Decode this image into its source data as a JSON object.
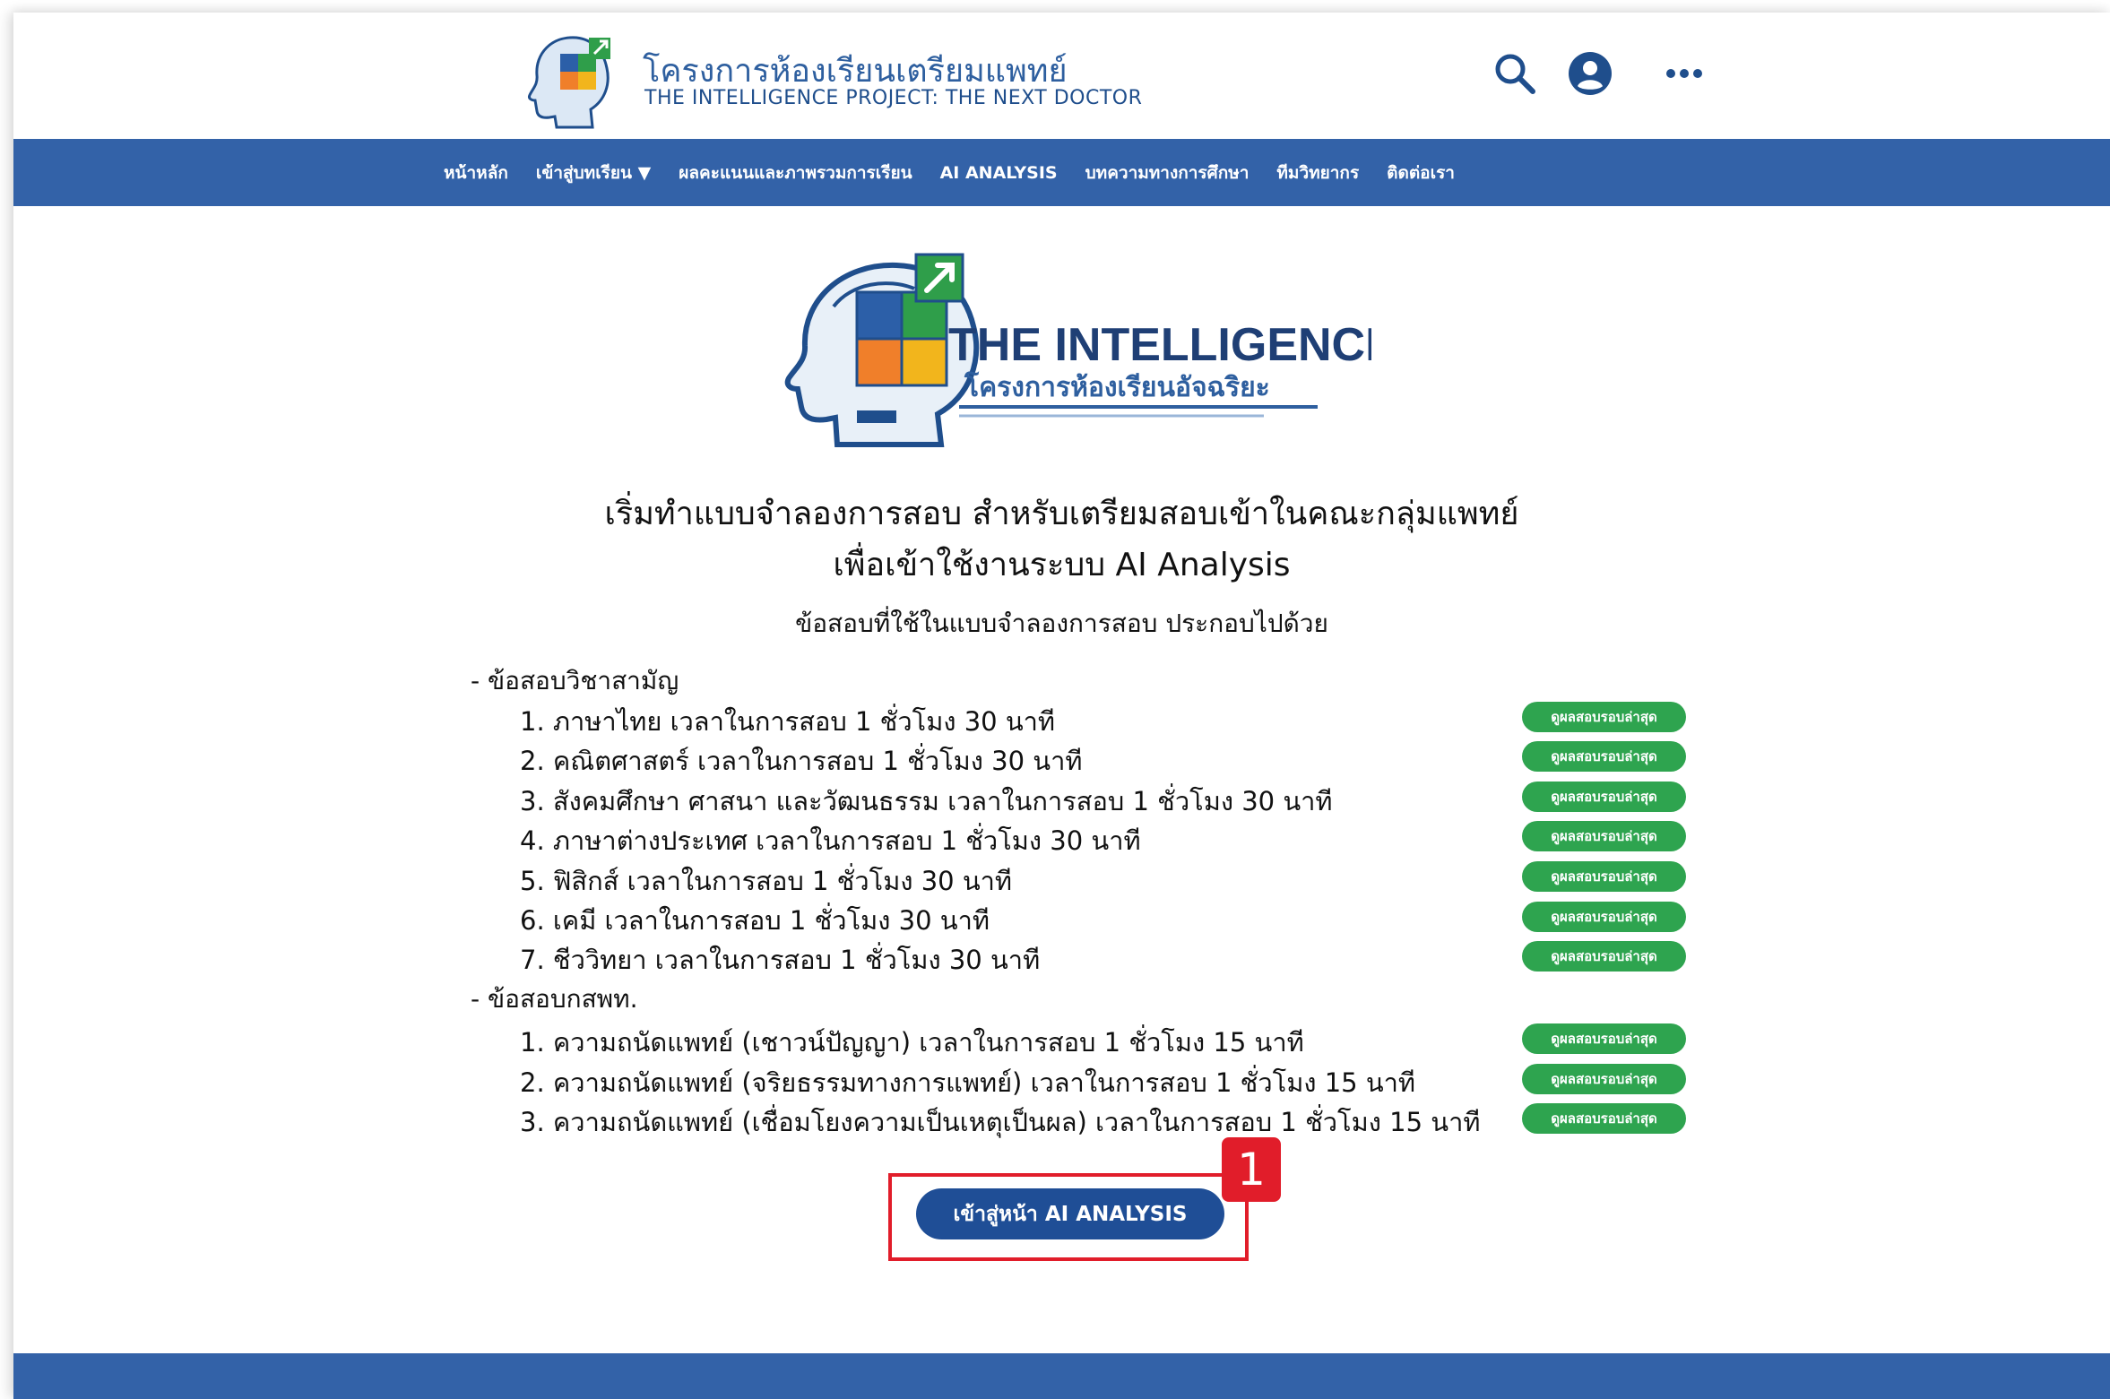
{
  "header": {
    "title": "โครงการห้องเรียนเตรียมแพทย์",
    "subtitle": "THE INTELLIGENCE PROJECT: THE NEXT DOCTOR",
    "icons": [
      "search-icon",
      "account-icon",
      "more-icon"
    ]
  },
  "nav": {
    "items": [
      {
        "label": "หน้าหลัก"
      },
      {
        "label": "เข้าสู่บทเรียน ▼"
      },
      {
        "label": "ผลคะแนนและภาพรวมการเรียน"
      },
      {
        "label": "AI ANALYSIS"
      },
      {
        "label": "บทความทางการศึกษา"
      },
      {
        "label": "ทีมวิทยากร"
      },
      {
        "label": "ติดต่อเรา"
      }
    ]
  },
  "hero": {
    "logo_title": "THE INTELLIGENCE",
    "logo_subtitle": "โครงการห้องเรียนอัจฉริยะ"
  },
  "main": {
    "heading_line1": "เริ่มทำแบบจำลองการสอบ สำหรับเตรียมสอบเข้าในคณะกลุ่มแพทย์",
    "heading_line2": "เพื่อเข้าใช้งานระบบ AI Analysis",
    "subheading": "ข้อสอบที่ใช้ในแบบจำลองการสอบ ประกอบไปด้วย",
    "result_button_label": "ดูผลสอบรอบล่าสุด",
    "sections": [
      {
        "label": "- ข้อสอบวิชาสามัญ",
        "items": [
          "1. ภาษาไทย เวลาในการสอบ 1 ชั่วโมง 30 นาที",
          "2. คณิตศาสตร์ เวลาในการสอบ 1 ชั่วโมง 30 นาที",
          "3. สังคมศึกษา ศาสนา และวัฒนธรรม เวลาในการสอบ 1 ชั่วโมง 30 นาที",
          "4. ภาษาต่างประเทศ เวลาในการสอบ 1 ชั่วโมง 30 นาที",
          "5. ฟิสิกส์ เวลาในการสอบ 1 ชั่วโมง 30 นาที",
          "6. เคมี เวลาในการสอบ 1 ชั่วโมง 30 นาที",
          "7. ชีววิทยา เวลาในการสอบ 1 ชั่วโมง 30 นาที"
        ]
      },
      {
        "label": "- ข้อสอบกสพท.",
        "items": [
          "1. ความถนัดแพทย์ (เชาวน์ปัญญา) เวลาในการสอบ 1 ชั่วโมง 15 นาที",
          "2. ความถนัดแพทย์ (จริยธรรมทางการแพทย์) เวลาในการสอบ 1 ชั่วโมง 15 นาที",
          "3. ความถนัดแพทย์ (เชื่อมโยงความเป็นเหตุเป็นผล) เวลาในการสอบ 1 ชั่วโมง 15 นาที"
        ]
      }
    ],
    "cta_label": "เข้าสู่หน้า AI ANALYSIS"
  },
  "annotation": {
    "marker_label": "1",
    "highlight_color": "#e11d2a"
  },
  "colors": {
    "primary": "#3362a8",
    "cta": "#1f4e96",
    "success": "#2ea44f",
    "brand_text": "#2e5f9f"
  }
}
